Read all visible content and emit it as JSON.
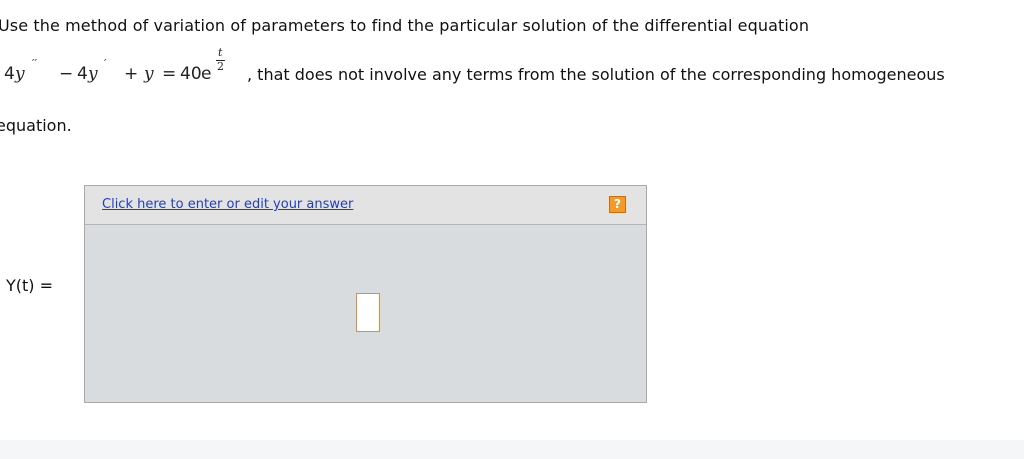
{
  "question": {
    "intro": "Use the method of variation of parameters to find the particular solution of the differential equation",
    "equation": {
      "coef1": "4",
      "var": "y",
      "primes2": "′′",
      "minus": "−",
      "coef2": "4",
      "prime1": "′",
      "plus": "+",
      "equals": "=",
      "rhs_coef": "40",
      "rhs_base": "e",
      "exp_num": "t",
      "exp_den": "2"
    },
    "continuation": ", that does not involve any terms from the solution of the corresponding homogeneous",
    "last_word": "equation."
  },
  "answer": {
    "label": "Y(t) =",
    "link_text": "Click here to enter or edit your answer",
    "help_glyph": "?"
  }
}
